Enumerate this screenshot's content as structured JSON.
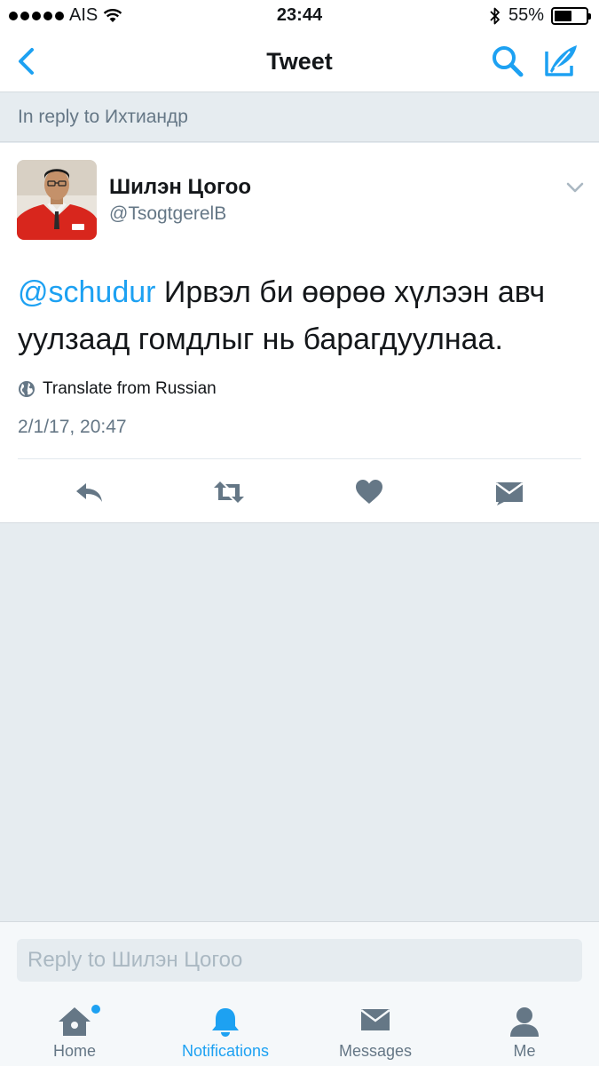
{
  "status_bar": {
    "carrier": "AIS",
    "time": "23:44",
    "battery_percent": "55%",
    "battery_level": 0.55
  },
  "nav": {
    "title": "Tweet",
    "back_icon": "chevron-left-icon",
    "search_icon": "search-icon",
    "compose_icon": "compose-icon"
  },
  "reply_context": "In reply to Ихтиандр",
  "tweet": {
    "display_name": "Шилэн Цогоо",
    "handle": "@TsogtgerelB",
    "mention": "@schudur",
    "text": " Ирвэл би өөрөө хүлээн авч уулзаад гомдлыг нь барагдуулнаа.",
    "translate": "Translate from Russian",
    "timestamp": "2/1/17, 20:47",
    "actions": [
      "reply-icon",
      "retweet-icon",
      "like-icon",
      "direct-message-icon"
    ]
  },
  "reply_bar": {
    "placeholder": "Reply to Шилэн Цогоо"
  },
  "tabs": [
    {
      "label": "Home",
      "icon": "home-icon"
    },
    {
      "label": "Notifications",
      "icon": "bell-icon"
    },
    {
      "label": "Messages",
      "icon": "envelope-icon"
    },
    {
      "label": "Me",
      "icon": "person-icon"
    }
  ],
  "colors": {
    "accent": "#1da1f2",
    "icon_gray": "#657786",
    "background": "#e6ecf0"
  }
}
